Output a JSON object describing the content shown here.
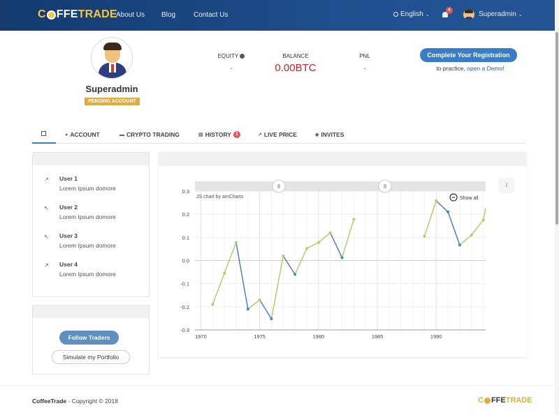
{
  "nav": {
    "logo_c": "C",
    "logo_rest": "FFE",
    "logo_trade": "TRADE",
    "links": [
      "About Us",
      "Blog",
      "Contact Us"
    ],
    "language": "English",
    "notifications_count": "4",
    "user": "Superadmin"
  },
  "profile": {
    "name": "Superadmin",
    "status": "PENDING ACCOUNT",
    "equity_label": "EQUITY",
    "equity_value": "-",
    "balance_label": "BALANCE",
    "balance_value": "0.00BTC",
    "pnl_label": "PNL",
    "pnl_value": "-",
    "register_button": "Complete Your Registration",
    "practice_text": "to practice,",
    "demo_link": "open a Demo!"
  },
  "tabs": [
    {
      "label": "ACCOUNT",
      "icon": "user-icon"
    },
    {
      "label": "CRYPTO TRADING",
      "icon": "car-icon"
    },
    {
      "label": "HISTORY",
      "icon": "history-icon",
      "badge": "1"
    },
    {
      "label": "LIVE PRICE",
      "icon": "trend-icon"
    },
    {
      "label": "INVITES",
      "icon": "users-icon"
    }
  ],
  "users": [
    {
      "name": "User 1",
      "desc": "Lorem Ipsum domore",
      "arrow": "↗"
    },
    {
      "name": "User 2",
      "desc": "Lorem Ipsum domore",
      "arrow": "↖"
    },
    {
      "name": "User 3",
      "desc": "Lorem Ipsum domore",
      "arrow": "↖"
    },
    {
      "name": "User 4",
      "desc": "Lorem Ipsum domore",
      "arrow": "↗"
    }
  ],
  "buttons": {
    "follow": "Follow Traders",
    "simulate": "Simulate my Portfolio"
  },
  "chart_data": {
    "type": "line",
    "credit": "JS chart by amCharts",
    "show_all": "Show all",
    "x_ticks": [
      "1970",
      "1975",
      "1980",
      "1985",
      "1990"
    ],
    "y_ticks": [
      "0.3",
      "0.2",
      "0.1",
      "0.0",
      "-0.1",
      "-0.2",
      "-0.3"
    ],
    "ylim": [
      -0.3,
      0.3
    ],
    "xlim": [
      1969.5,
      1994.2
    ],
    "grid": true,
    "series": [
      {
        "color_up": "#b5cc6e",
        "color_down": "#4a81c0",
        "points": [
          [
            1971,
            -0.19
          ],
          [
            1972,
            -0.055
          ],
          [
            1973,
            0.078
          ],
          [
            1974,
            -0.21
          ],
          [
            1975,
            -0.17
          ],
          [
            1976,
            -0.252
          ],
          [
            1977,
            0.02
          ],
          [
            1978,
            -0.06
          ],
          [
            1979,
            0.052
          ],
          [
            1980,
            0.078
          ],
          [
            1981,
            0.12
          ],
          [
            1982,
            0.012
          ],
          [
            1983,
            0.178
          ],
          null,
          [
            1989,
            0.105
          ],
          [
            1990,
            0.258
          ],
          [
            1991,
            0.21
          ],
          [
            1992,
            0.067
          ],
          [
            1993,
            0.11
          ],
          [
            1994,
            0.175
          ],
          [
            1994.2,
            0.225
          ]
        ]
      }
    ]
  },
  "footer": {
    "brand": "CoffeeTrade",
    "copyright": " - Copyright © 2018"
  }
}
